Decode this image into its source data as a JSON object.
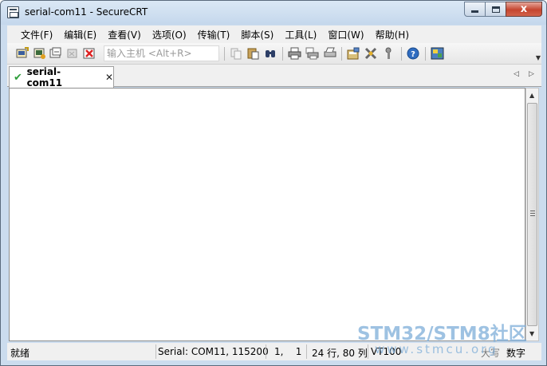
{
  "window": {
    "title": "serial-com11 - SecureCRT",
    "buttons": {
      "minimize": "",
      "maximize": "",
      "close": "x"
    }
  },
  "menu": [
    {
      "label": "文件(F)"
    },
    {
      "label": "编辑(E)"
    },
    {
      "label": "查看(V)"
    },
    {
      "label": "选项(O)"
    },
    {
      "label": "传输(T)"
    },
    {
      "label": "脚本(S)"
    },
    {
      "label": "工具(L)"
    },
    {
      "label": "窗口(W)"
    },
    {
      "label": "帮助(H)"
    }
  ],
  "toolbar": {
    "host_input_placeholder": "输入主机 <Alt+R>",
    "icons": [
      "quick-connect-icon",
      "connect-in-tab-icon",
      "reconnect-icon",
      "disconnect-icon",
      "copy-icon",
      "paste-icon",
      "find-icon",
      "print-icon",
      "print-selection-icon",
      "print-setup-icon",
      "session-options-icon",
      "global-options-icon",
      "keymap-icon",
      "help-icon",
      "screenshot-icon"
    ]
  },
  "tabs": [
    {
      "label": "serial-com11",
      "status_icon": "check-icon",
      "active": true
    }
  ],
  "tab_nav": {
    "prev": "◁",
    "next": "▷"
  },
  "statusbar": {
    "ready": "就绪",
    "connection": "Serial: COM11, 115200",
    "cursor_pos": "1,    1",
    "size": "24 行, 80 列",
    "terminal_type": "VT100",
    "caps": "大写",
    "num": "数字"
  },
  "watermark": {
    "main": "STM32/STM8社区",
    "sub": "www.stmcu.org"
  },
  "colors": {
    "frame": "#cbdcee",
    "close_button": "#c5452f",
    "tab_check": "#2e9e3a",
    "watermark": "#7eaed9"
  }
}
